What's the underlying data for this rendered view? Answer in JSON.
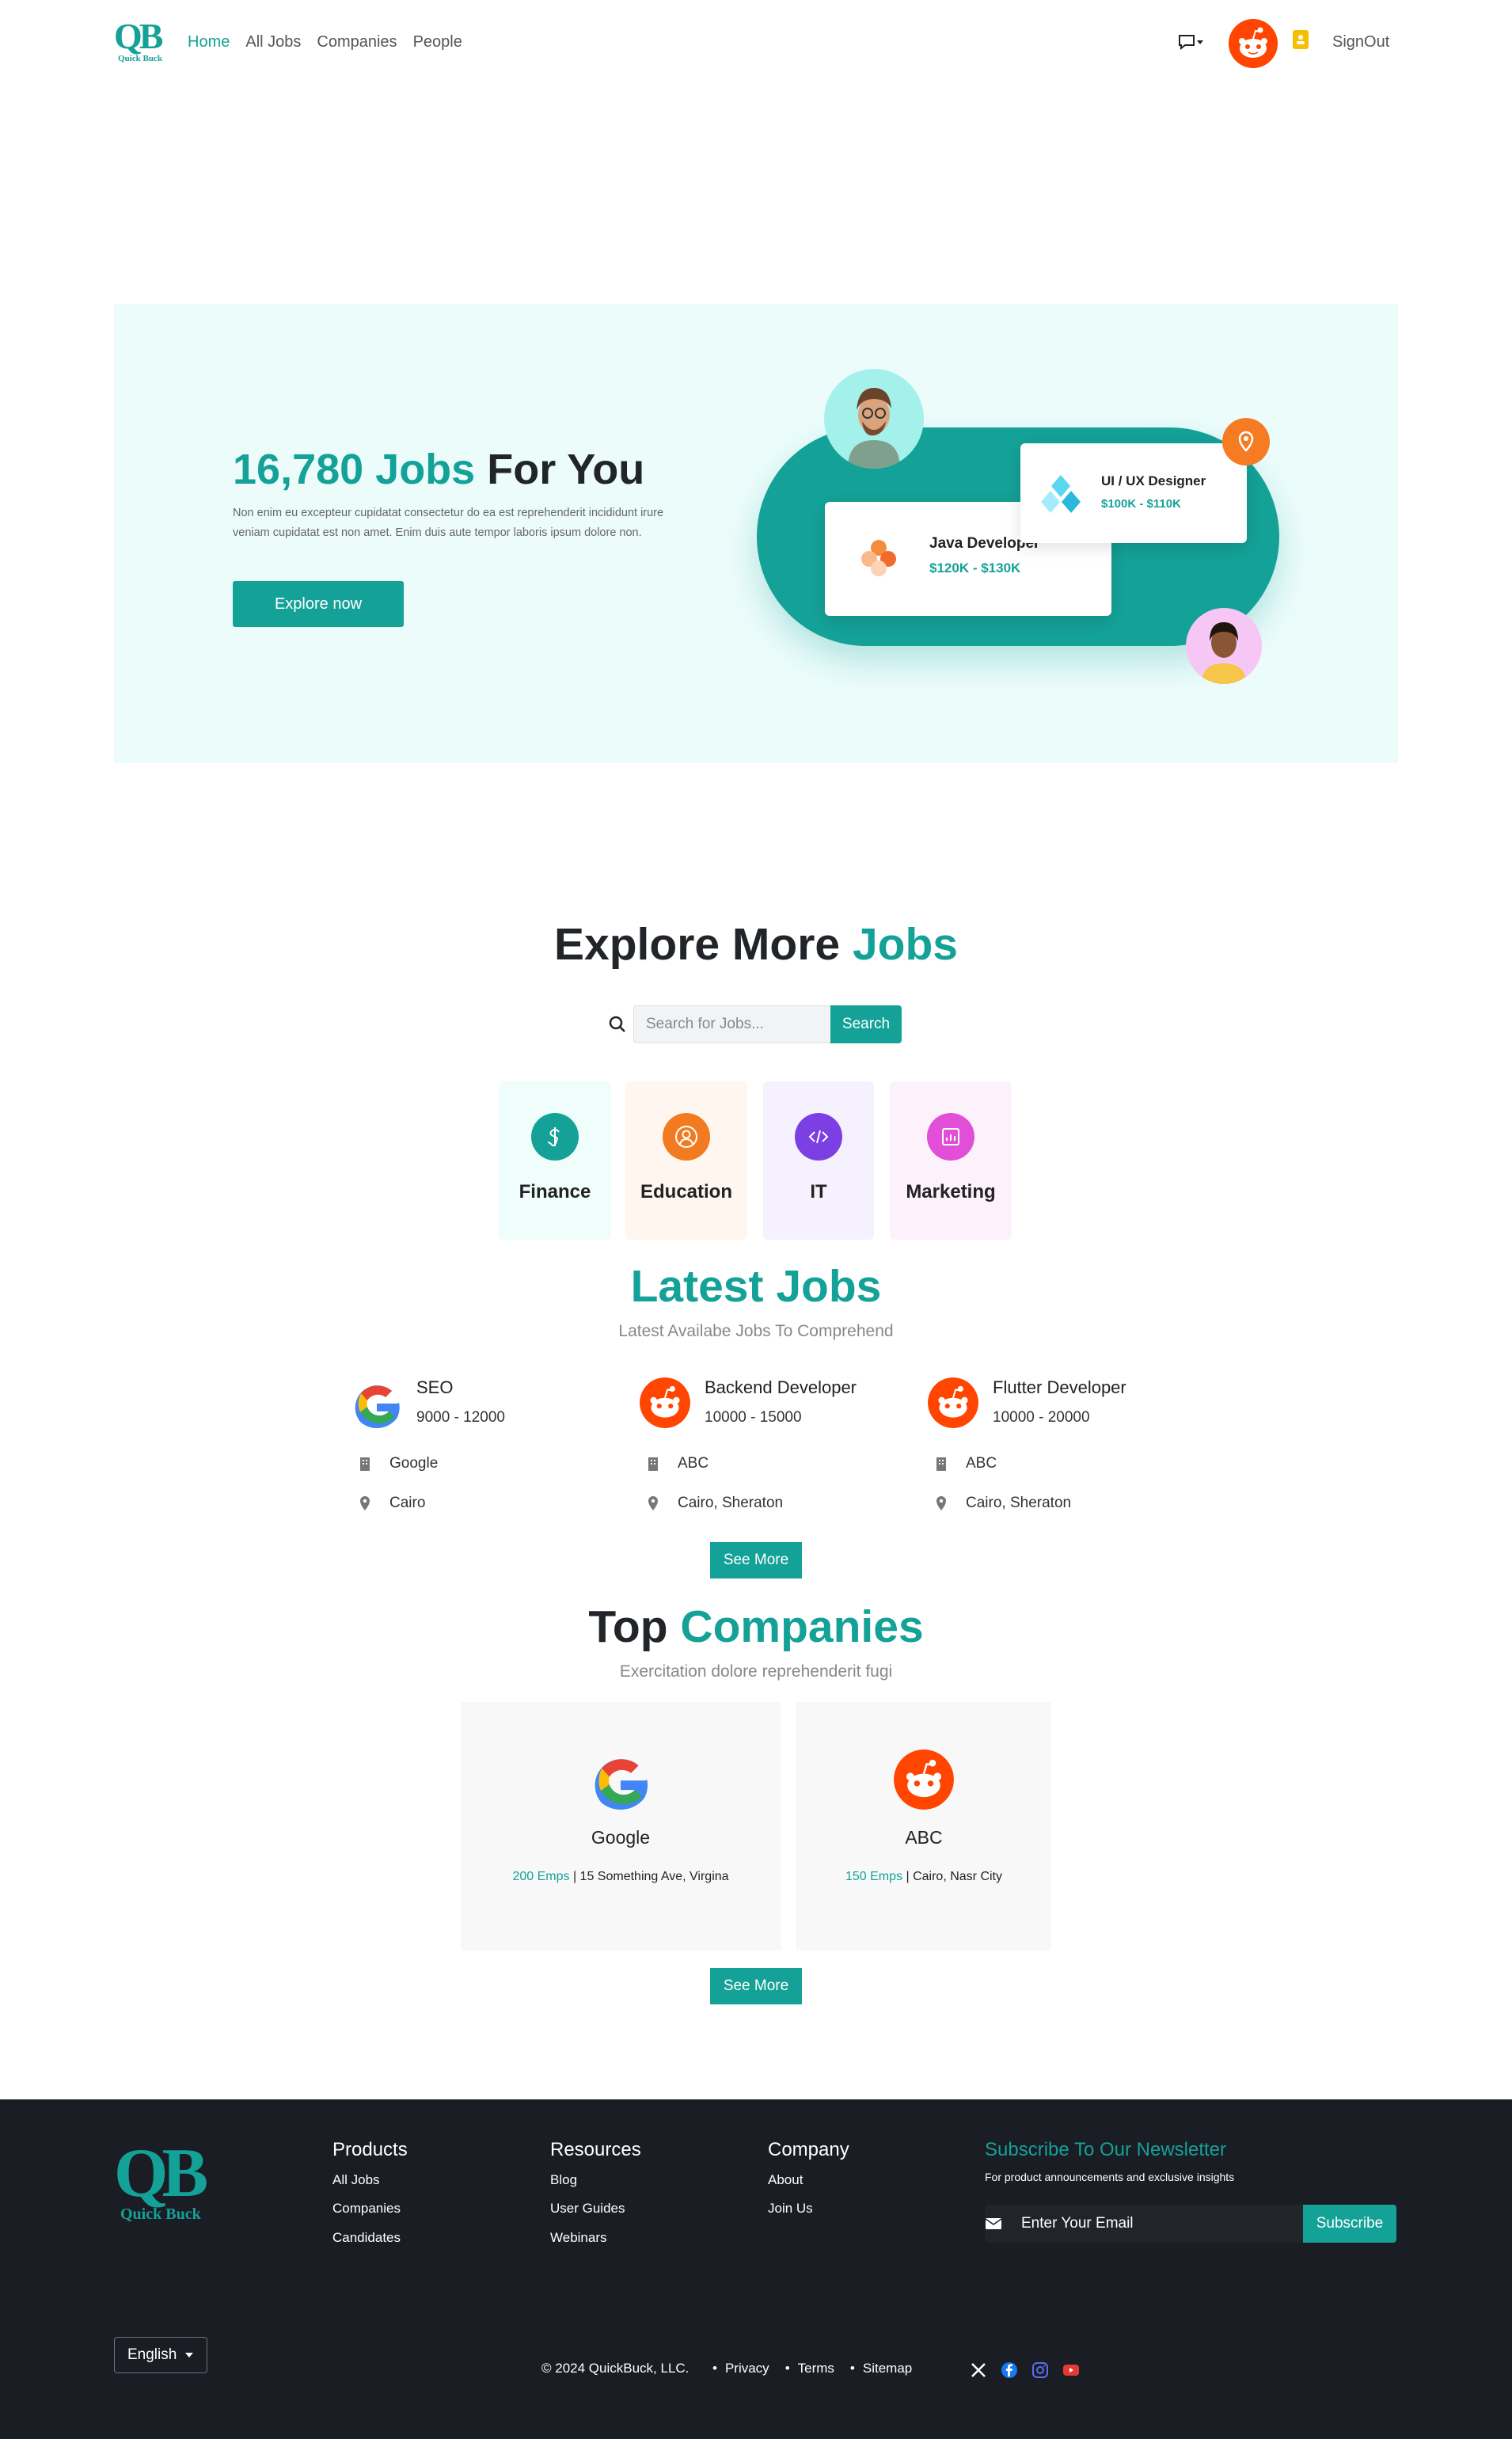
{
  "nav": {
    "logo_text": "QB",
    "logo_sub": "Quick Buck",
    "links": [
      "Home",
      "All Jobs",
      "Companies",
      "People"
    ],
    "signout": "SignOut"
  },
  "hero": {
    "title_highlight": "16,780 Jobs",
    "title_rest": "For You",
    "description": "Non enim eu excepteur cupidatat consectetur do ea est reprehenderit incididunt irure veniam cupidatat est non amet. Enim duis aute tempor laboris ipsum dolore non.",
    "cta": "Explore now",
    "card1": {
      "title": "Java Developer",
      "salary": "$120K - $130K"
    },
    "card2": {
      "title": "UI / UX Designer",
      "salary": "$100K - $110K"
    }
  },
  "explore": {
    "title_main": "Explore More",
    "title_highlight": "Jobs",
    "search_placeholder": "Search for Jobs...",
    "search_button": "Search",
    "categories": [
      {
        "label": "Finance",
        "icon": "dollar-icon",
        "bg": "#effdfb",
        "color": "#14a197"
      },
      {
        "label": "Education",
        "icon": "user-circle-icon",
        "bg": "#fff6ef",
        "color": "#f27b22"
      },
      {
        "label": "IT",
        "icon": "code-icon",
        "bg": "#f5f1fe",
        "color": "#7b3fe4"
      },
      {
        "label": "Marketing",
        "icon": "chart-icon",
        "bg": "#fdf1fc",
        "color": "#e14ed7"
      }
    ]
  },
  "latest": {
    "title": "Latest Jobs",
    "subtitle": "Latest Availabe Jobs To Comprehend",
    "jobs": [
      {
        "title": "SEO",
        "salary": "9000 - 12000",
        "company": "Google",
        "location": "Cairo",
        "logo": "google-logo"
      },
      {
        "title": "Backend Developer",
        "salary": "10000 - 15000",
        "company": "ABC",
        "location": "Cairo, Sheraton",
        "logo": "reddit-logo"
      },
      {
        "title": "Flutter Developer",
        "salary": "10000 - 20000",
        "company": "ABC",
        "location": "Cairo, Sheraton",
        "logo": "reddit-logo"
      }
    ],
    "see_more": "See More"
  },
  "companies": {
    "title_main": "Top",
    "title_highlight": "Companies",
    "subtitle": "Exercitation dolore reprehenderit fugi",
    "list": [
      {
        "name": "Google",
        "emps": "200 Emps",
        "address": "| 15 Something Ave, Virgina"
      },
      {
        "name": "ABC",
        "emps": "150 Emps",
        "address": "| Cairo, Nasr City"
      }
    ],
    "see_more": "See More"
  },
  "footer": {
    "logo_text": "QB",
    "logo_sub": "Quick Buck",
    "products": {
      "title": "Products",
      "links": [
        "All Jobs",
        "Companies",
        "Candidates"
      ]
    },
    "resources": {
      "title": "Resources",
      "links": [
        "Blog",
        "User Guides",
        "Webinars"
      ]
    },
    "company": {
      "title": "Company",
      "links": [
        "About",
        "Join Us"
      ]
    },
    "newsletter": {
      "title": "Subscribe To Our Newsletter",
      "subtitle": "For product announcements and exclusive insights",
      "placeholder": "Enter Your Email",
      "button": "Subscribe"
    },
    "language": "English",
    "copyright": "© 2024 QuickBuck, LLC.",
    "links": [
      "Privacy",
      "Terms",
      "Sitemap"
    ]
  },
  "colors": {
    "accent": "#14a197",
    "footer_bg": "#1a1d23"
  }
}
